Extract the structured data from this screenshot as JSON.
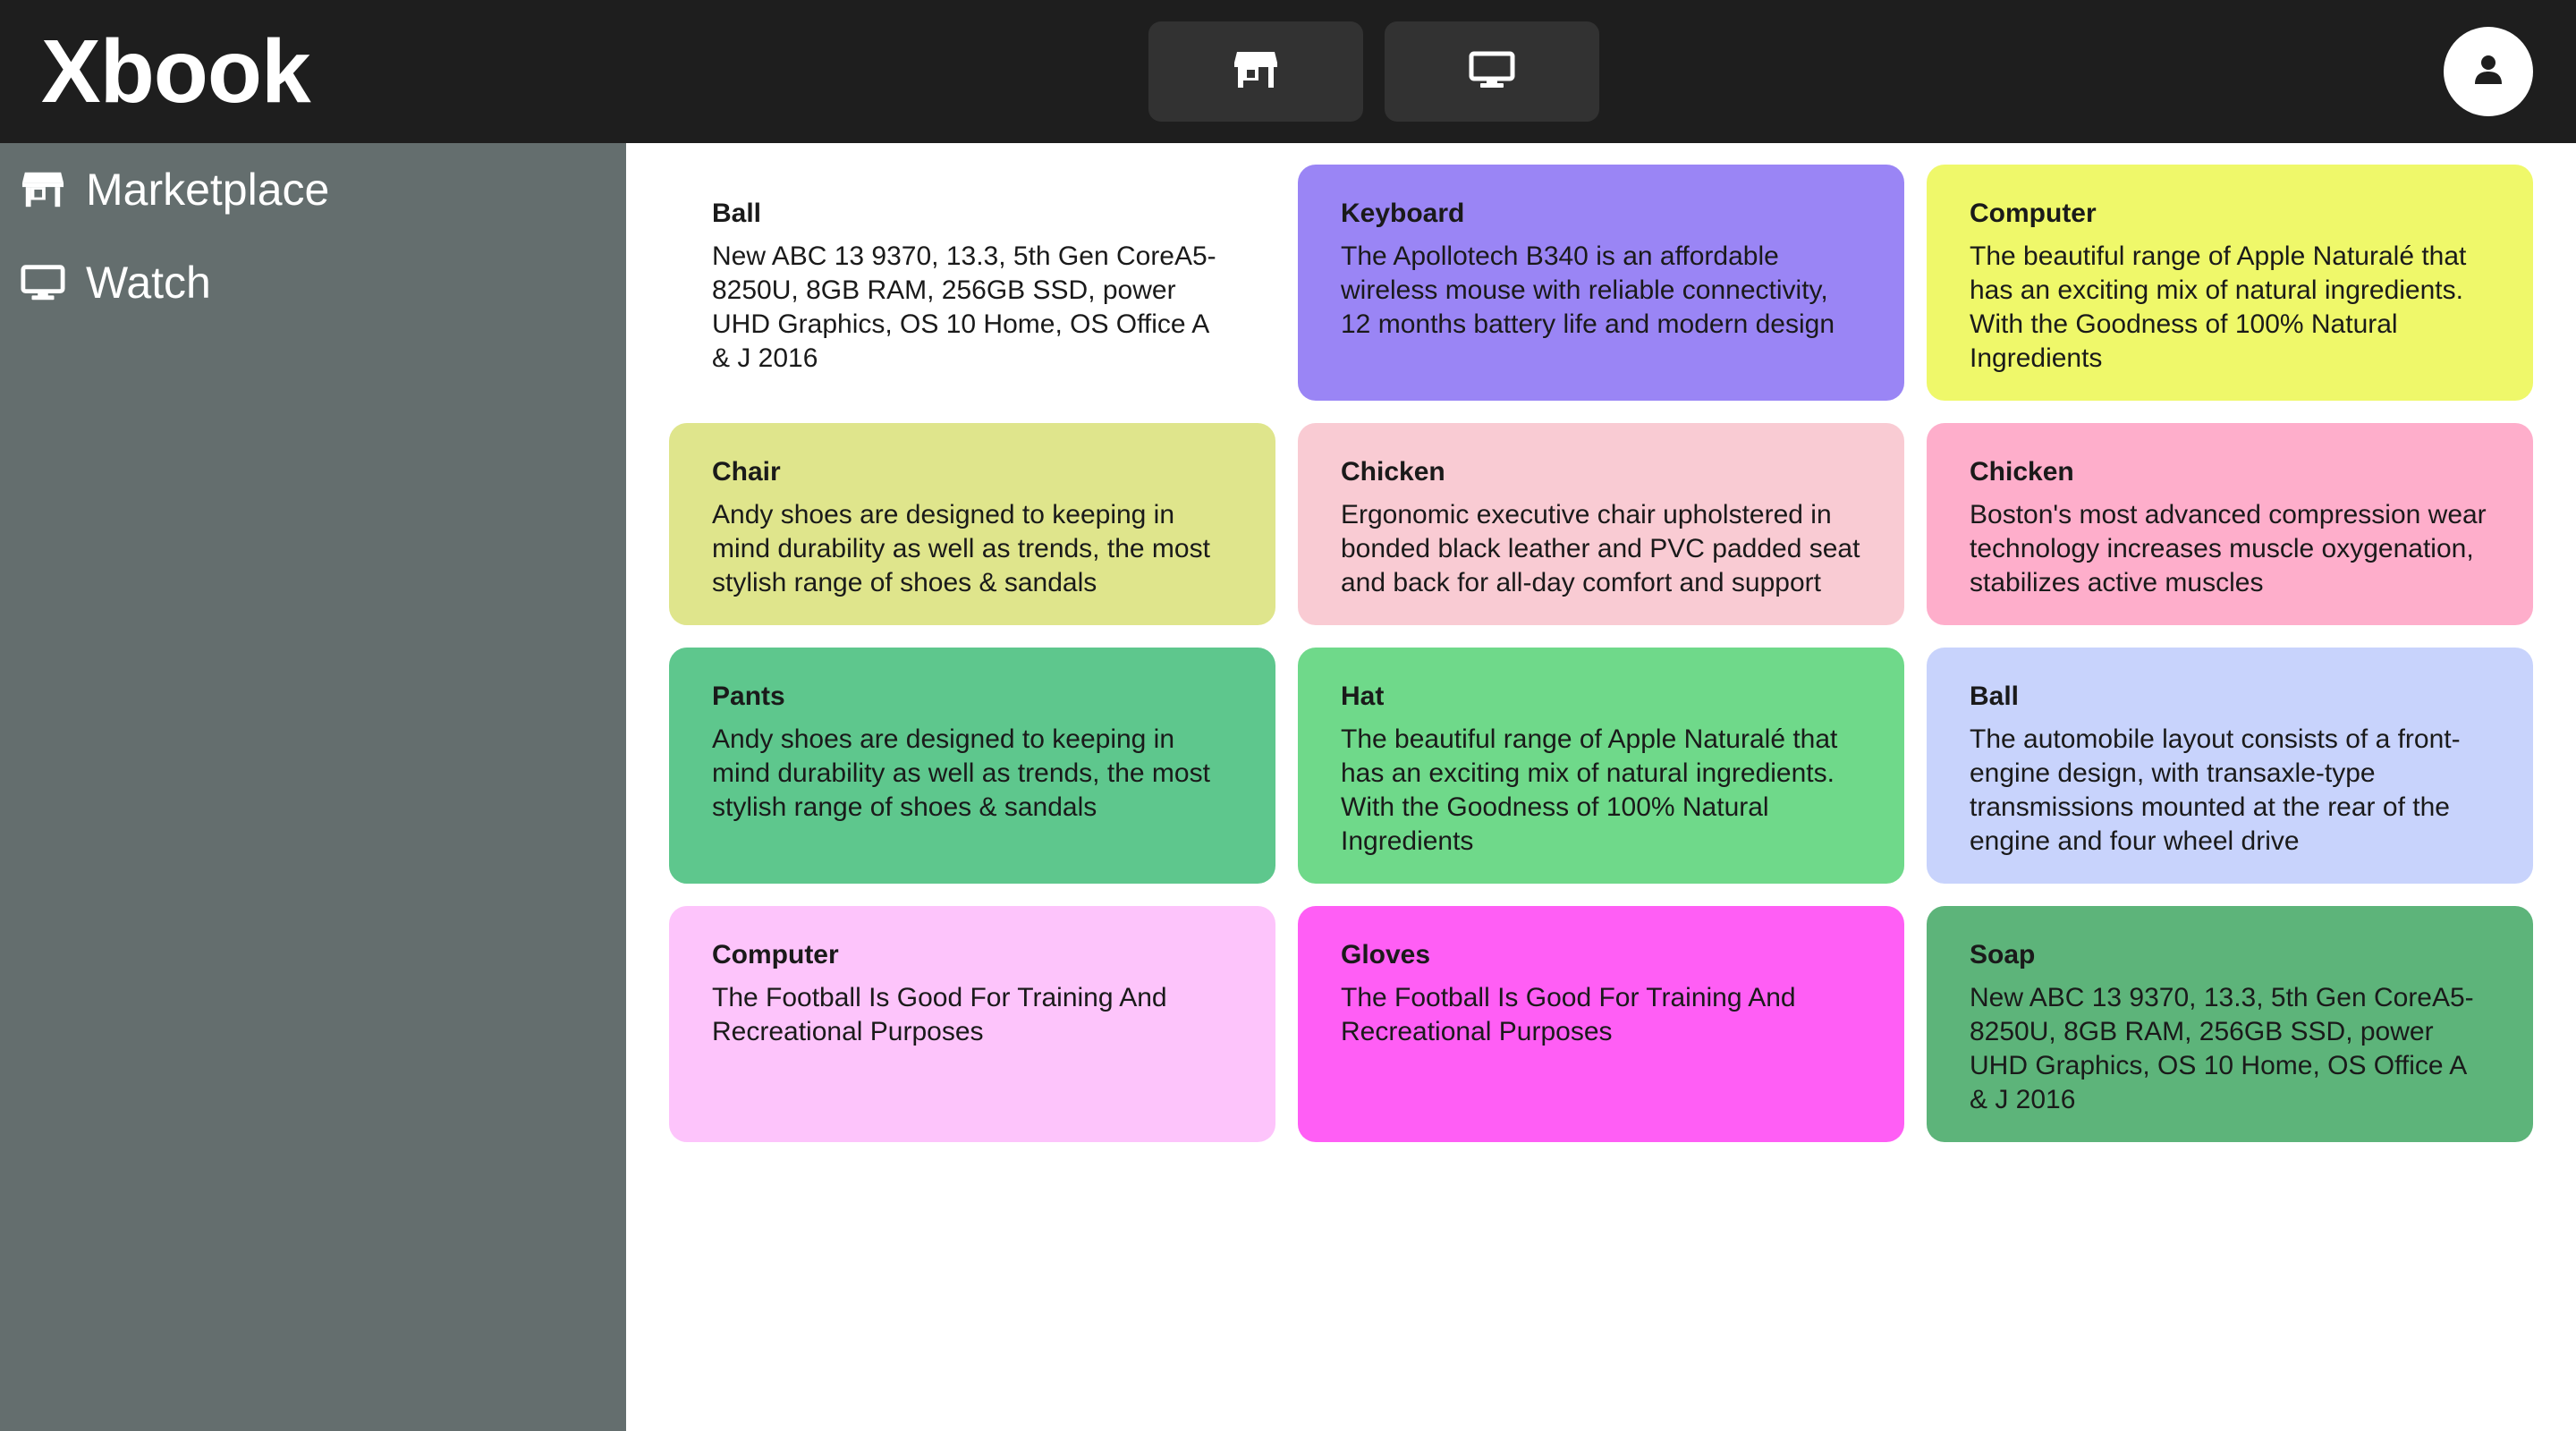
{
  "header": {
    "brand": "Xbook",
    "background": "#1e1e1e",
    "nav_buttons": [
      {
        "icon": "store-icon",
        "label": "Marketplace"
      },
      {
        "icon": "monitor-icon",
        "label": "Watch"
      }
    ],
    "avatar_icon": "user-icon"
  },
  "sidebar": {
    "background": "#646e6e",
    "items": [
      {
        "icon": "store-icon",
        "label": "Marketplace"
      },
      {
        "icon": "monitor-icon",
        "label": "Watch"
      }
    ]
  },
  "products": [
    {
      "title": "Ball",
      "description": "New ABC 13 9370, 13.3, 5th Gen CoreA5-8250U, 8GB RAM, 256GB SSD, power UHD Graphics, OS 10 Home, OS Office A & J 2016",
      "color": "#ffffff"
    },
    {
      "title": "Keyboard",
      "description": "The Apollotech B340 is an affordable wireless mouse with reliable connectivity, 12 months battery life and modern design",
      "color": "#9a85f5"
    },
    {
      "title": "Computer",
      "description": "The beautiful range of Apple Naturalé that has an exciting mix of natural ingredients. With the Goodness of 100% Natural Ingredients",
      "color": "#eff86a"
    },
    {
      "title": "Chair",
      "description": "Andy shoes are designed to keeping in mind durability as well as trends, the most stylish range of shoes & sandals",
      "color": "#dfe58c"
    },
    {
      "title": "Chicken",
      "description": "Ergonomic executive chair upholstered in bonded black leather and PVC padded seat and back for all-day comfort and support",
      "color": "#f9cbd3"
    },
    {
      "title": "Chicken",
      "description": "Boston's most advanced compression wear technology increases muscle oxygenation, stabilizes active muscles",
      "color": "#feaecb"
    },
    {
      "title": "Pants",
      "description": "Andy shoes are designed to keeping in mind durability as well as trends, the most stylish range of shoes & sandals",
      "color": "#5ec78d"
    },
    {
      "title": "Hat",
      "description": "The beautiful range of Apple Naturalé that has an exciting mix of natural ingredients. With the Goodness of 100% Natural Ingredients",
      "color": "#6fd98a"
    },
    {
      "title": "Ball",
      "description": "The automobile layout consists of a front-engine design, with transaxle-type transmissions mounted at the rear of the engine and four wheel drive",
      "color": "#c8d3fc"
    },
    {
      "title": "Computer",
      "description": "The Football Is Good For Training And Recreational Purposes",
      "color": "#fdc4fb"
    },
    {
      "title": "Gloves",
      "description": "The Football Is Good For Training And Recreational Purposes",
      "color": "#ff5ef5"
    },
    {
      "title": "Soap",
      "description": "New ABC 13 9370, 13.3, 5th Gen CoreA5-8250U, 8GB RAM, 256GB SSD, power UHD Graphics, OS 10 Home, OS Office A & J 2016",
      "color": "#5db47a"
    }
  ]
}
